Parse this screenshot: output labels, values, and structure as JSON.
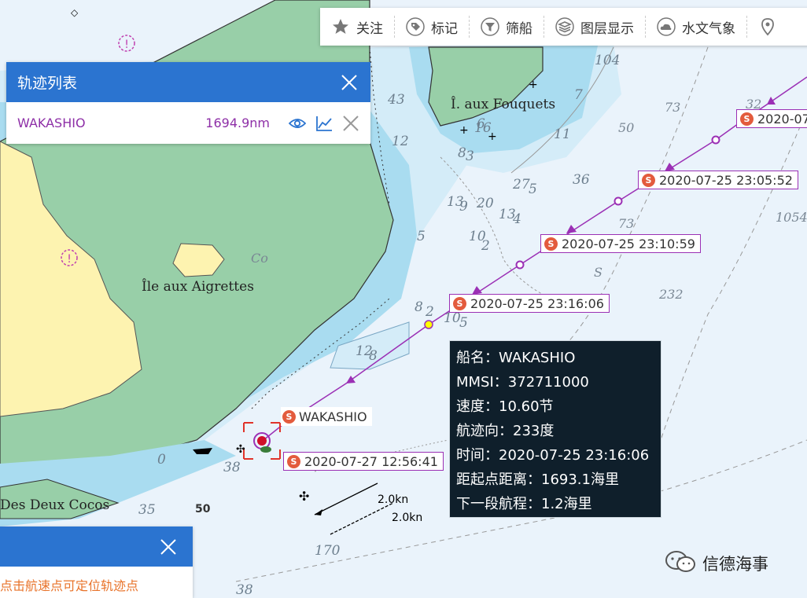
{
  "toolbar": {
    "items": [
      {
        "label": "关注",
        "icon": "star-icon"
      },
      {
        "label": "标记",
        "icon": "tag-icon"
      },
      {
        "label": "筛船",
        "icon": "filter-icon"
      },
      {
        "label": "图层显示",
        "icon": "layers-icon"
      },
      {
        "label": "水文气象",
        "icon": "cloud-icon"
      }
    ]
  },
  "track_panel": {
    "title": "轨迹列表",
    "row": {
      "ship_name": "WAKASHIO",
      "distance": "1694.9nm"
    }
  },
  "hint_panel": {
    "text": "点击航速点可定位轨迹点"
  },
  "time_labels": [
    "2020-07",
    "2020-07-25 23:05:52",
    "2020-07-25 23:10:59",
    "2020-07-25 23:16:06",
    "2020-07-27 12:56:41"
  ],
  "ship_label": "WAKASHIO",
  "tooltip": {
    "lines": [
      "船名：WAKASHIO",
      "MMSI：372711000",
      "速度：10.60节",
      "航迹向：233度",
      "时间：2020-07-25 23:16:06",
      "距起点距离：1693.1海里",
      "下一段航程：1.2海里"
    ]
  },
  "map": {
    "place_names": [
      "Î. aux Fouquets",
      "Île aux Aigrettes",
      "Des Deux Cocos"
    ],
    "soundings": [
      "104",
      "43",
      "12",
      "6",
      "8",
      "3",
      "16",
      "11",
      "7",
      "50",
      "73",
      "32",
      "36",
      "27",
      "5",
      "13",
      "9",
      "20",
      "13",
      "4",
      "73",
      "10",
      "2",
      "5",
      "S",
      "232",
      "1054",
      "Co",
      "8",
      "2",
      "10",
      "5",
      "12",
      "8",
      "0",
      "38",
      "35",
      "50",
      "170",
      "2.0kn",
      "2.0kn",
      "38"
    ]
  },
  "watermark": "信德海事",
  "colors": {
    "land": "#fdf3b0",
    "green": "#98cfa8",
    "shallow": "#a9dcf0",
    "mid": "#d4ecf8",
    "deep": "#eaf3fb",
    "track": "#9b30b5",
    "header_blue": "#2b74d0"
  }
}
